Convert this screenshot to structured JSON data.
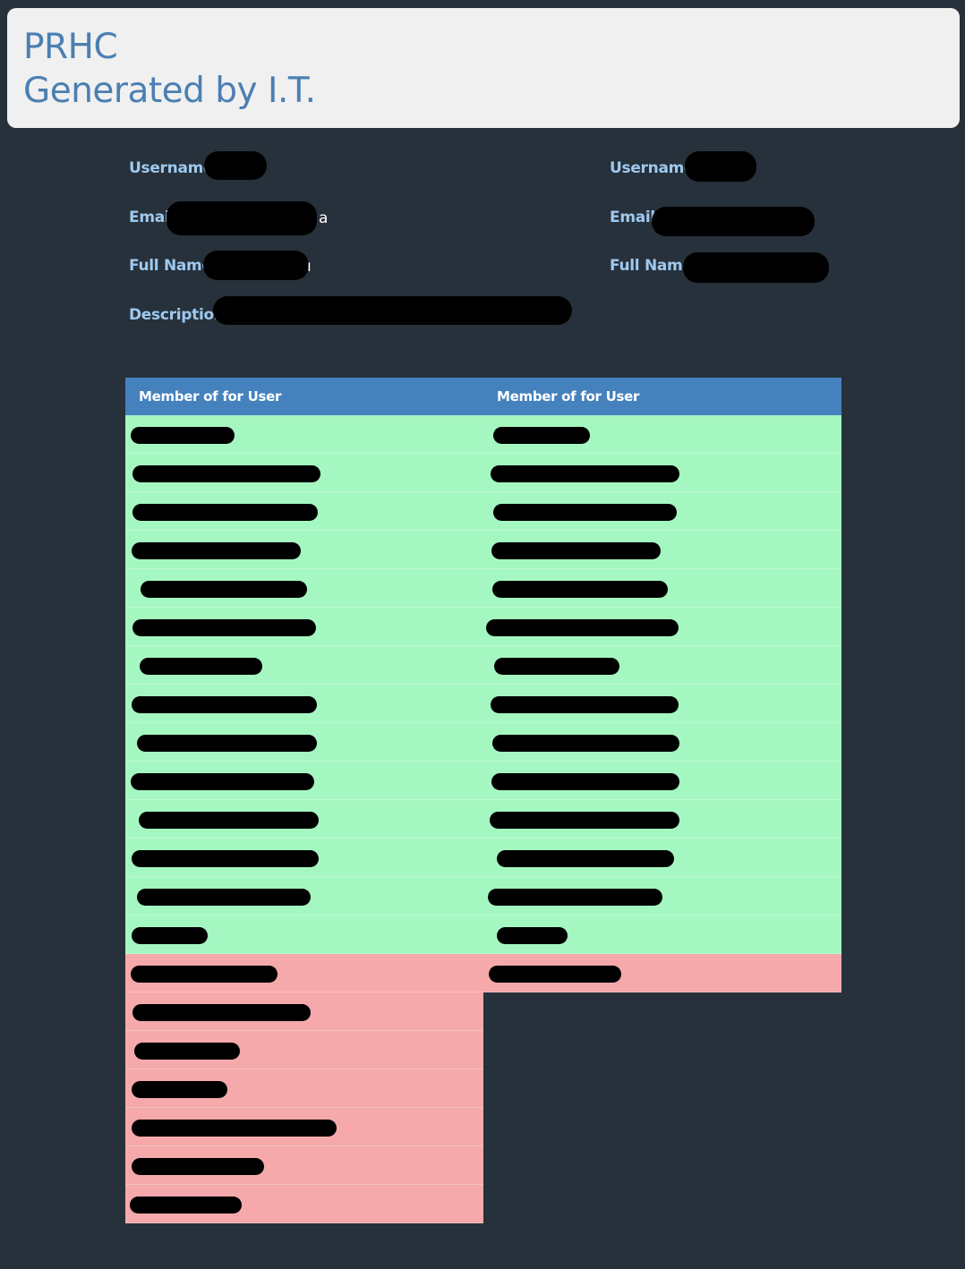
{
  "header": {
    "line1": "PRHC",
    "line2": "Generated by I.T."
  },
  "user_left": {
    "username_label": "Username",
    "email_label": "Email",
    "email_suffix": "a",
    "fullname_label": "Full Name",
    "fullname_suffix": "ı",
    "description_label": "Description"
  },
  "user_right": {
    "username_label": "Username",
    "email_label": "Email",
    "fullname_label": "Full Name"
  },
  "tables": [
    {
      "header": "Member of for User",
      "green_rows": 14,
      "red_rows": 7
    },
    {
      "header": "Member of for User",
      "green_rows": 14,
      "red_rows": 1
    }
  ],
  "colors": {
    "background": "#27313b",
    "header_text": "#4b7fb2",
    "label_text": "#9ec9ef",
    "table_header": "#4582bd",
    "row_member": "#a5f7c1",
    "row_nonmember": "#f5a9aa"
  }
}
